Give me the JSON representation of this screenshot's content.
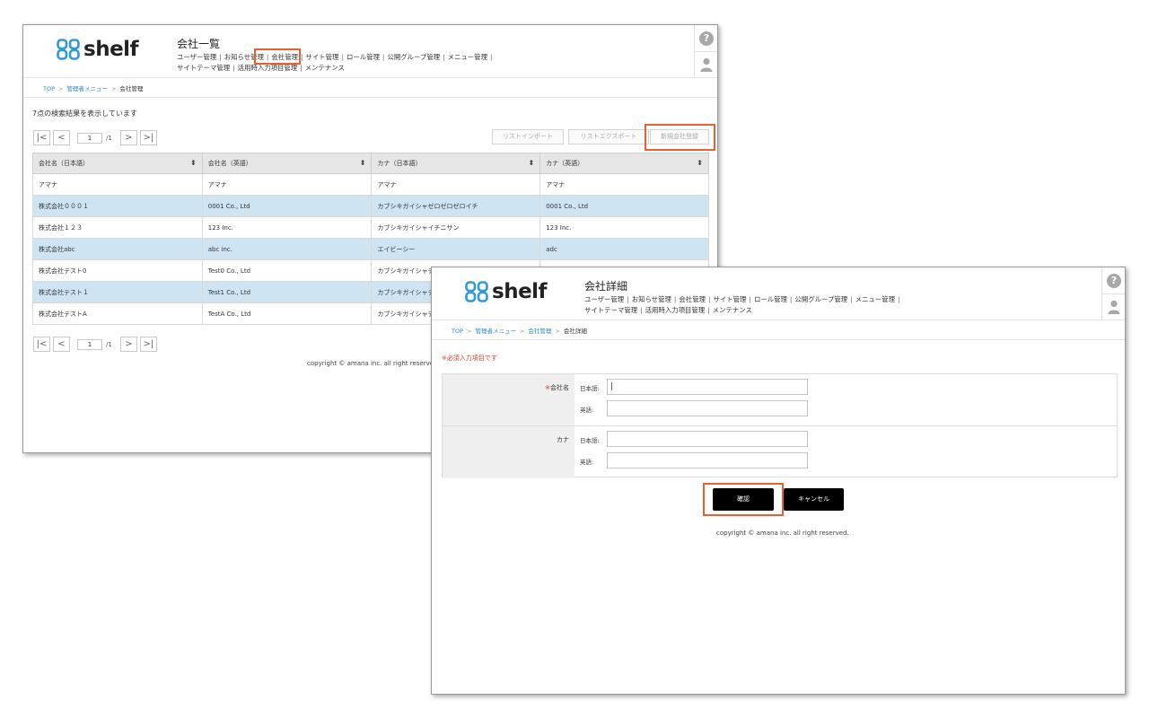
{
  "logo": {
    "text": "shelf",
    "color": "#2f9ad8"
  },
  "list_window": {
    "title": "会社一覧",
    "nav_line1": [
      "ユーザー管理",
      "お知らせ管理",
      "会社管理",
      "サイト管理",
      "ロール管理",
      "公開グループ管理",
      "メニュー管理"
    ],
    "nav_line2": [
      "サイトテーマ管理",
      "活用時入力項目管理",
      "メンテナンス"
    ],
    "breadcrumb": {
      "top": "TOP",
      "admin_menu": "管理者メニュー",
      "current": "会社管理"
    },
    "result_text": "7点の検索結果を表示しています",
    "pager": {
      "first": "|<",
      "prev": "<",
      "page": "1",
      "total": "/1",
      "next": ">",
      "last": ">|"
    },
    "buttons": {
      "import": "リストインポート",
      "export": "リストエクスポート",
      "new_company": "新規会社登録"
    },
    "table": {
      "headers": [
        "会社名（日本語）",
        "会社名（英語）",
        "カナ（日本語）",
        "カナ（英語）"
      ],
      "rows": [
        [
          "アマナ",
          "アマナ",
          "アマナ",
          "アマナ"
        ],
        [
          "株式会社０００１",
          "0001 Co., Ltd",
          "カブシキガイシャゼロゼロゼロイチ",
          "0001 Co., Ltd"
        ],
        [
          "株式会社１２３",
          "123 Inc.",
          "カブシキガイシャイチニサン",
          "123 Inc."
        ],
        [
          "株式会社abc",
          "abc inc.",
          "エイビーシー",
          "adc"
        ],
        [
          "株式会社テスト0",
          "Test0 Co., Ltd",
          "カブシキガイシャテ",
          ""
        ],
        [
          "株式会社テスト１",
          "Test1 Co., Ltd",
          "カブシキガイシャテ",
          ""
        ],
        [
          "株式会社テストA",
          "TestA Co., Ltd",
          "カブシキガイシャテ",
          ""
        ]
      ]
    },
    "copyright": "copyright © amana inc. all right reserved."
  },
  "detail_window": {
    "title": "会社詳細",
    "nav_line1": [
      "ユーザー管理",
      "お知らせ管理",
      "会社管理",
      "サイト管理",
      "ロール管理",
      "公開グループ管理",
      "メニュー管理"
    ],
    "nav_line2": [
      "サイトテーマ管理",
      "活用時入力項目管理",
      "メンテナンス"
    ],
    "breadcrumb": {
      "top": "TOP",
      "admin_menu": "管理者メニュー",
      "company": "会社管理",
      "current": "会社詳細"
    },
    "required_note": "※必須入力項目です",
    "form": {
      "company_name_label": "会社名",
      "required_mark": "※",
      "kana_label": "カナ",
      "japanese_sub": "日本語:",
      "english_sub": "英語:",
      "company_name_ja_value": "|",
      "company_name_en_value": "",
      "kana_ja_value": "",
      "kana_en_value": ""
    },
    "buttons": {
      "confirm": "確認",
      "cancel": "キャンセル"
    },
    "copyright": "copyright © amana inc. all right reserved."
  },
  "colors": {
    "highlight": "#e8612c",
    "link": "#2b8ccf",
    "row_alt": "#cfe4f2",
    "required": "#e23b2b"
  },
  "icons": {
    "help": "question-circle-icon",
    "user": "user-silhouette-icon",
    "sort": "sort-updown-icon"
  }
}
